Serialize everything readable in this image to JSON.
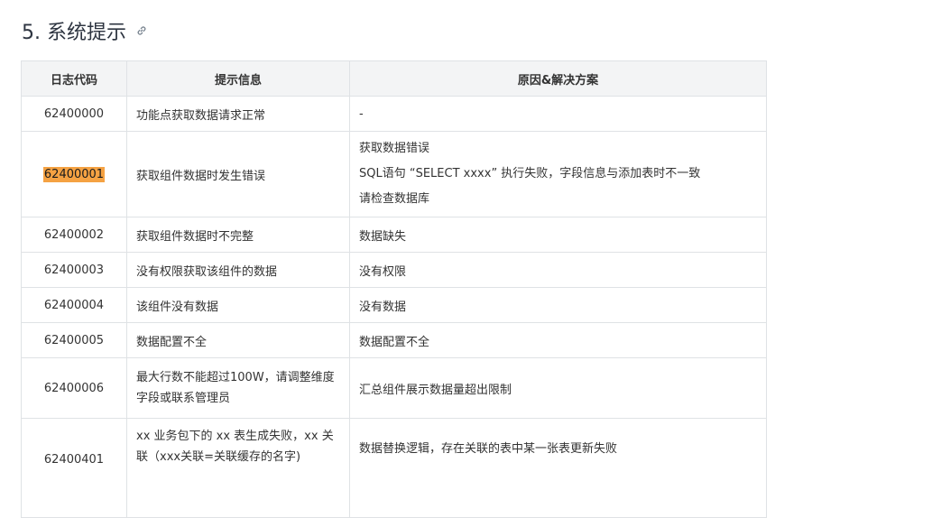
{
  "section": {
    "title": "5. 系统提示"
  },
  "table": {
    "headers": [
      "日志代码",
      "提示信息",
      "原因&解决方案"
    ],
    "rows": [
      {
        "code": "62400000",
        "message": "功能点获取数据请求正常",
        "reason": [
          "-"
        ]
      },
      {
        "code": "62400001",
        "message": "获取组件数据时发生错误",
        "reason": [
          "获取数据错误",
          "SQL语句 “SELECT xxxx” 执行失败，字段信息与添加表时不一致",
          "请检查数据库"
        ],
        "highlighted": true
      },
      {
        "code": "62400002",
        "message": "获取组件数据时不完整",
        "reason": [
          "数据缺失"
        ]
      },
      {
        "code": "62400003",
        "message": "没有权限获取该组件的数据",
        "reason": [
          "没有权限"
        ]
      },
      {
        "code": "62400004",
        "message": "该组件没有数据",
        "reason": [
          "没有数据"
        ]
      },
      {
        "code": "62400005",
        "message": "数据配置不全",
        "reason": [
          "数据配置不全"
        ]
      },
      {
        "code": "62400006",
        "message": "最大行数不能超过100W，请调整维度字段或联系管理员",
        "reason": [
          "汇总组件展示数据量超出限制"
        ]
      },
      {
        "code": "62400401",
        "message": "xx 业务包下的 xx 表生成失败，xx 关联（xxx关联=关联缓存的名字)",
        "reason": [
          "数据替换逻辑，存在关联的表中某一张表更新失败"
        ]
      }
    ]
  }
}
